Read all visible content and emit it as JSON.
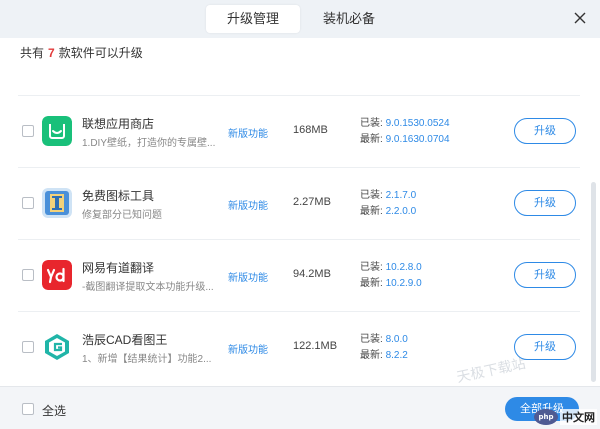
{
  "tabs": [
    {
      "label": "升级管理",
      "active": true
    },
    {
      "label": "装机必备",
      "active": false
    }
  ],
  "summary": {
    "prefix": "共有",
    "count": "7",
    "suffix": "款软件可以升级"
  },
  "installed_label": "已装:",
  "latest_label": "最新:",
  "apps": [
    {
      "name": "联想应用商店",
      "desc": "1.DIY壁纸，打造你的专属壁...",
      "feature": "新版功能",
      "size": "168MB",
      "installed": "9.0.1530.0524",
      "latest": "9.0.1630.0704",
      "button": "升级",
      "icon": "lenovo-store-icon"
    },
    {
      "name": "免费图标工具",
      "desc": "修复部分已知问题",
      "feature": "新版功能",
      "size": "2.27MB",
      "installed": "2.1.7.0",
      "latest": "2.2.0.0",
      "button": "升级",
      "icon": "icon-tool-icon"
    },
    {
      "name": "网易有道翻译",
      "desc": "-截图翻译提取文本功能升级...",
      "feature": "新版功能",
      "size": "94.2MB",
      "installed": "10.2.8.0",
      "latest": "10.2.9.0",
      "button": "升级",
      "icon": "youdao-icon"
    },
    {
      "name": "浩辰CAD看图王",
      "desc": "1、新增【结果统计】功能2...",
      "feature": "新版功能",
      "size": "122.1MB",
      "installed": "8.0.0",
      "latest": "8.2.2",
      "button": "升级",
      "icon": "gstarcad-icon"
    }
  ],
  "footer": {
    "select_all": "全选",
    "upgrade_all": "全部升级"
  },
  "watermark": "天极下载站",
  "site_badge": {
    "circle": "php",
    "text": "中文网"
  },
  "colors": {
    "accent": "#2e8ae6",
    "count": "#e23a3a",
    "titlebar": "#eef2f6"
  }
}
